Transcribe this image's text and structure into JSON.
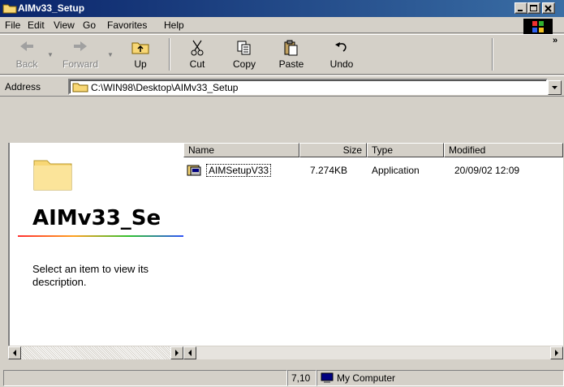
{
  "window": {
    "title": "AIMv33_Setup",
    "icon": "folder-icon"
  },
  "menu": [
    "File",
    "Edit",
    "View",
    "Go",
    "Favorites",
    "Help"
  ],
  "toolbar": {
    "back": "Back",
    "forward": "Forward",
    "up": "Up",
    "cut": "Cut",
    "copy": "Copy",
    "paste": "Paste",
    "undo": "Undo",
    "more": "»"
  },
  "address": {
    "label": "Address",
    "value": "C:\\WIN98\\Desktop\\AIMv33_Setup"
  },
  "left_pane": {
    "title": "AIMv33_Se",
    "description": "Select an item to view its description."
  },
  "columns": [
    "Name",
    "Size",
    "Type",
    "Modified"
  ],
  "files": [
    {
      "name": "AIMSetupV33",
      "size": "7.274KB",
      "type": "Application",
      "modified": "20/09/02 12:09",
      "icon": "installer-icon"
    }
  ],
  "status": {
    "size": "7,10",
    "zone": "My Computer"
  },
  "colors": {
    "titlebar": "#0a246a",
    "face": "#d4d0c8",
    "folder": "#f8d775"
  }
}
